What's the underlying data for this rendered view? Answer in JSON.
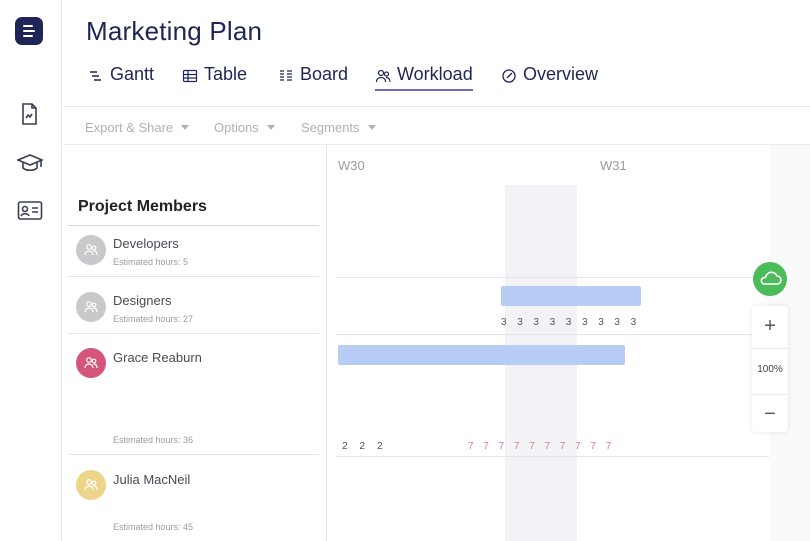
{
  "app": {
    "title": "Marketing Plan"
  },
  "tabs": [
    {
      "label": "Gantt",
      "icon": "gantt-icon"
    },
    {
      "label": "Table",
      "icon": "table-icon"
    },
    {
      "label": "Board",
      "icon": "board-icon"
    },
    {
      "label": "Workload",
      "icon": "workload-icon",
      "active": true
    },
    {
      "label": "Overview",
      "icon": "overview-icon"
    }
  ],
  "toolbar": {
    "export_label": "Export & Share",
    "options_label": "Options",
    "segments_label": "Segments"
  },
  "sidebar": {
    "icons": [
      "document-icon",
      "graduation-cap-icon",
      "contact-card-icon"
    ]
  },
  "members": {
    "heading": "Project Members",
    "items": [
      {
        "name": "Developers",
        "hours": "Estimated hours: 5",
        "avatar_color": "#c9c9cc"
      },
      {
        "name": "Designers",
        "hours": "Estimated hours: 27",
        "avatar_color": "#c9c9cc"
      },
      {
        "name": "Grace Reaburn",
        "hours": "Estimated hours: 36",
        "avatar_color": "#d4557a"
      },
      {
        "name": "Julia MacNeil",
        "hours": "Estimated hours: 45",
        "avatar_color": "#ecd58a"
      }
    ]
  },
  "timeline": {
    "weeks": [
      "W30",
      "W31"
    ],
    "designers_daily": [
      "3",
      "3",
      "3",
      "3",
      "3",
      "3",
      "3",
      "3",
      "3"
    ],
    "grace_daily_normal": [
      "2",
      "2",
      "2"
    ],
    "grace_daily_over": [
      "7",
      "7",
      "7",
      "7",
      "7",
      "7",
      "7",
      "7",
      "7",
      "7"
    ]
  },
  "zoom": {
    "level": "100%",
    "in_label": "+",
    "out_label": "−"
  },
  "colors": {
    "brand": "#1f2555",
    "accent": "#6a6ab8",
    "bar": "#b7cdf5",
    "overload": "#e07a88",
    "cloud": "#4cbb5a"
  }
}
